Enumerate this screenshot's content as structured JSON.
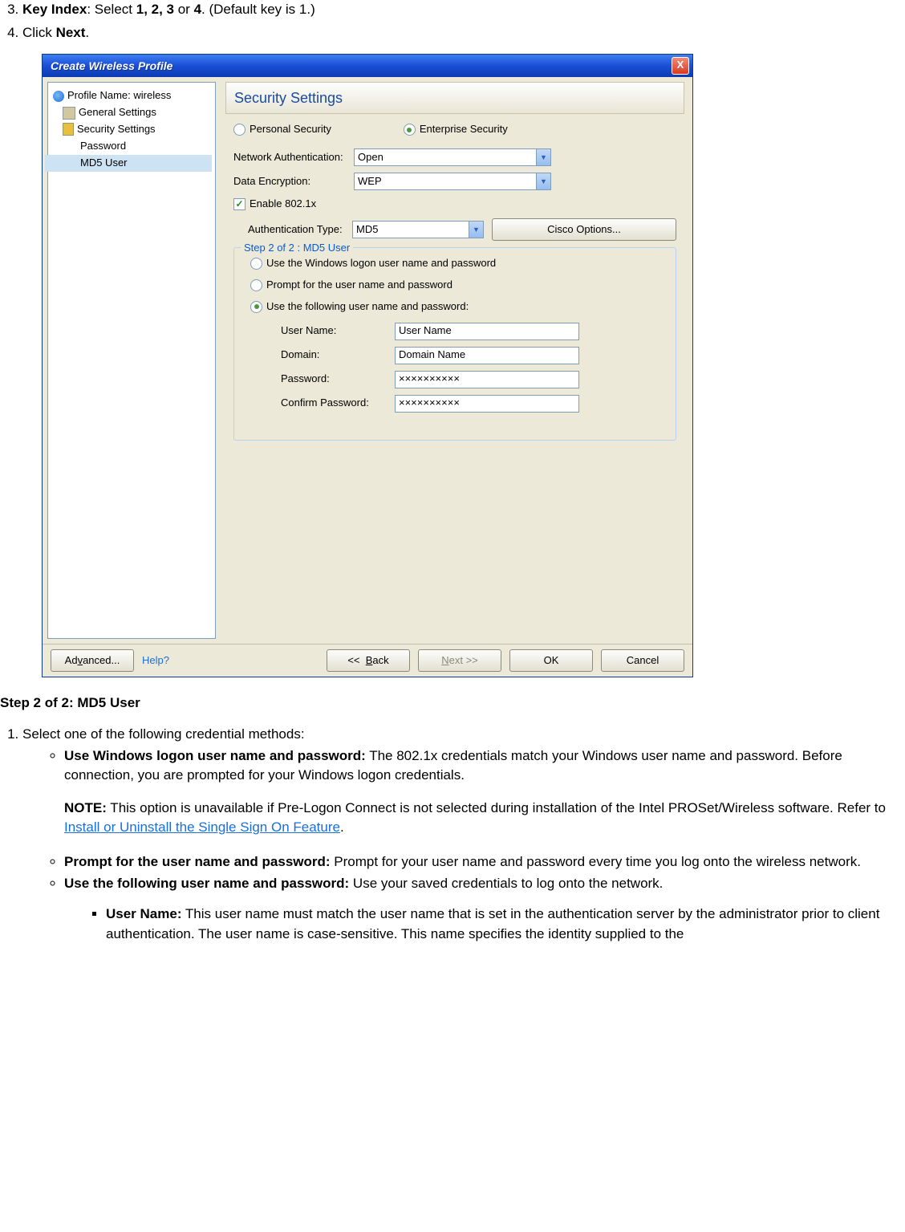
{
  "doc": {
    "item3_pre": "Key Index",
    "item3_mid": ": Select ",
    "item3_bold2": "1, 2, 3",
    "item3_mid2": " or ",
    "item3_bold3": "4",
    "item3_post": ". (Default key is 1.)",
    "item4_pre": "Click ",
    "item4_bold": "Next",
    "item4_post": ".",
    "step_title": "Step 2 of 2: MD5 User",
    "s1": "Select one of the following credential methods:",
    "b1_t": "Use Windows logon user name and password:",
    "b1_txt": " The 802.1x credentials match your Windows user name and password. Before connection, you are prompted for your Windows logon credentials.",
    "note_b": "NOTE:",
    "note_txt1": " This option is unavailable if Pre-Logon Connect is not selected during installation of the Intel PROSet/Wireless software. Refer to ",
    "note_link": "Install or Uninstall the Single Sign On Feature",
    "note_txt2": ".",
    "b2_t": "Prompt for the user name and password:",
    "b2_txt": " Prompt for your user name and password every time you log onto the wireless network.",
    "b3_t": "Use the following user name and password:",
    "b3_txt": " Use your saved credentials to log onto the network.",
    "sq1_t": "User Name:",
    "sq1_txt": " This user name must match the user name that is set in the authentication server by the administrator prior to client authentication. The user name is case-sensitive. This name specifies the identity supplied to the"
  },
  "win": {
    "title": "Create Wireless Profile",
    "close": "X",
    "tree": {
      "profile": "Profile Name: wireless",
      "general": "General Settings",
      "security": "Security Settings",
      "password": "Password",
      "md5": "MD5 User"
    },
    "panel_header": "Security Settings",
    "sec": {
      "personal": "Personal Security",
      "enterprise": "Enterprise Security",
      "netauth_lbl": "Network Authentication:",
      "netauth_val": "Open",
      "dataenc_lbl": "Data Encryption:",
      "dataenc_val": "WEP",
      "enable_chk": "Enable 802.1x",
      "authtype_lbl": "Authentication Type:",
      "authtype_val": "MD5",
      "cisco_btn": "Cisco Options..."
    },
    "group": {
      "title": "Step 2 of 2 : MD5 User",
      "r1": "Use the Windows logon user name and password",
      "r2": "Prompt for the user name and password",
      "r3": "Use the following user name and password:",
      "user_lbl": "User Name:",
      "user_val": "User Name",
      "domain_lbl": "Domain:",
      "domain_val": "Domain Name",
      "pass_lbl": "Password:",
      "pass_val": "××××××××××",
      "cpass_lbl": "Confirm Password:",
      "cpass_val": "××××××××××"
    },
    "footer": {
      "advanced": "Advanced...",
      "help": "Help?",
      "back": "<<  Back",
      "next": "Next >>",
      "ok": "OK",
      "cancel": "Cancel"
    }
  }
}
